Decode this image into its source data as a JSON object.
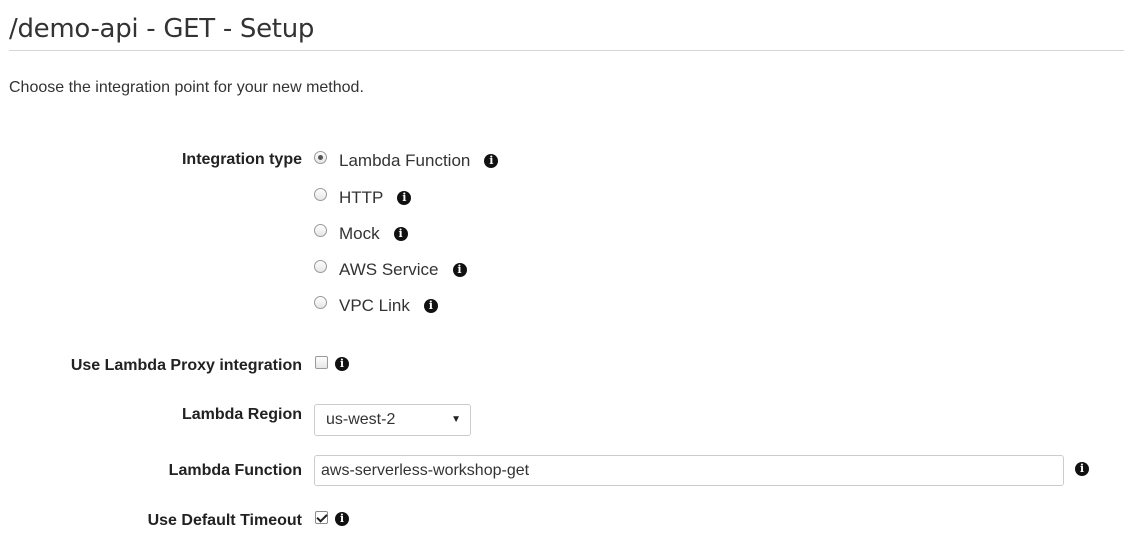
{
  "header": {
    "title": "/demo-api - GET - Setup",
    "intro": "Choose the integration point for your new method."
  },
  "integration_type": {
    "label": "Integration type",
    "selected": "Lambda Function",
    "options": [
      {
        "label": "Lambda Function",
        "checked": true
      },
      {
        "label": "HTTP",
        "checked": false
      },
      {
        "label": "Mock",
        "checked": false
      },
      {
        "label": "AWS Service",
        "checked": false
      },
      {
        "label": "VPC Link",
        "checked": false
      }
    ]
  },
  "lambda_proxy": {
    "label": "Use Lambda Proxy integration",
    "checked": false
  },
  "lambda_region": {
    "label": "Lambda Region",
    "value": "us-west-2"
  },
  "lambda_function": {
    "label": "Lambda Function",
    "value": "aws-serverless-workshop-get"
  },
  "default_timeout": {
    "label": "Use Default Timeout",
    "checked": true
  },
  "icons": {
    "info": "info-icon",
    "info_glyph": "i",
    "select_arrow": "▼"
  }
}
